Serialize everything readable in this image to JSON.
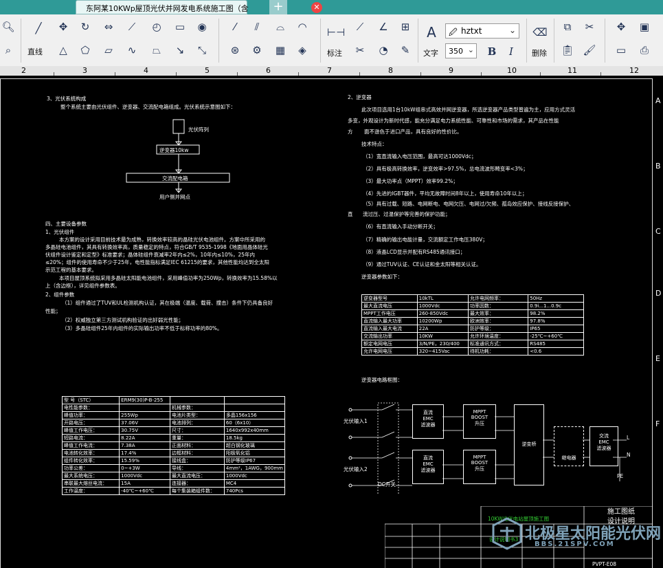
{
  "window": {
    "tab_title": "东阿某10KWp屋顶光伏并网发电系统施工图（含",
    "close_glyph": "✕",
    "new_tab_glyph": "+"
  },
  "toolbar": {
    "line_label": "直线",
    "dimension_label": "标注",
    "text_label": "文字",
    "delete_label": "删除",
    "font_name": "hztxt",
    "font_size": "350",
    "bold": "B",
    "italic": "I",
    "text_glyph": "A"
  },
  "ruler": {
    "numbers": [
      "2",
      "3",
      "4",
      "5",
      "6",
      "7",
      "8",
      "9",
      "10",
      "11",
      "12"
    ]
  },
  "row_letters": [
    "A",
    "B",
    "C",
    "D",
    "E",
    "F"
  ],
  "doc": {
    "left": {
      "sec3_title": "3、光伏系统构成",
      "sec3_body": "整个系统主要由光伏组件、逆变器、交流配电箱组成。光伏系统示意图如下：",
      "flow": {
        "pv": "光伏阵列",
        "inv": "逆变器10kw",
        "ac": "交流配电箱",
        "grid": "用户侧并网点"
      },
      "sec4_title": "四、主要设备参数",
      "p1_title": "1、光伏组件",
      "p1_l1": "本方案的设计采用目前技术最为成熟，转换效率较高的晶硅光伏电池组件。方案中所采用的",
      "p1_l2": "多晶硅电池组件，其具有转换效率高，质量稳定的特点，符合GB/T 9535-1998《地面用晶体硅光",
      "p1_l3": "伏组件设计鉴定和定型》标准要求；晶体硅组件衰减率2年内≤2%，10年内≤10%，25年内",
      "p1_l4": "≤20%；组件的使用寿命不少于25年，电性能指标满足IEC 61215的要求，其他性能均达到全太阳",
      "p1_l5": "示范工程的基本要求。",
      "p1_l6": "本项目屋顶系统拟采用多晶硅太阳能电池组件，采用峰值功率为250Wp，转换效率为15.58%以",
      "p1_l7": "上（含边框），详见组件参数表。",
      "p2_title": "2、组件参数",
      "p2_l1": "（1）组件通过了TUV和UL检测机构认证，其在极端（温度、载荷、撞击）条件下仍具备良好",
      "p2_l2": "性能；",
      "p2_l3": "（2）权威独立第三方测试机构验证的出好弱光性能；",
      "p2_l4": "（3）多晶硅组件25年内组件的实际输出功率不低于标称功率的80%。"
    },
    "module_table": {
      "rows": [
        [
          "型 号（STC）",
          "ERM9(30)P-B-255",
          "",
          ""
        ],
        [
          "电性能参数：",
          "",
          "机械参数：",
          ""
        ],
        [
          "峰值功率：",
          "255Wp",
          "电池片类型：",
          "多晶156x156"
        ],
        [
          "开路电压：",
          "37.06V",
          "电池排列：",
          "60（6x10）"
        ],
        [
          "峰值工作电压：",
          "30.75V",
          "尺寸：",
          "1640x992x40mm"
        ],
        [
          "短路电流：",
          "8.22A",
          "重量：",
          "18.5kg"
        ],
        [
          "峰值工作电流：",
          "7.38A",
          "正面材料：",
          "超白钢化玻璃"
        ],
        [
          "电池转化效率：",
          "17.4%",
          "边框材料：",
          "阳极氧化铝"
        ],
        [
          "组件转化效率：",
          "15.59%",
          "接线盒：",
          "防护等级IP67"
        ],
        [
          "功率公差：",
          "0~+3W",
          "导线：",
          "4mm²，1AWG，900mm"
        ],
        [
          "最大系统电压：",
          "1000Vdc",
          "最大直流电压：",
          "1000Vdc"
        ],
        [
          "串联最大熔丝电流：",
          "15A",
          "连接器：",
          "MC4"
        ],
        [
          "工作温度：",
          "-40℃~+60℃",
          "每个集装箱组件数：",
          "740Pcs"
        ]
      ]
    },
    "right": {
      "inv_title": "2、逆变器",
      "inv_l1": "此次项目选用1台10kW组串式高效并网逆变器，所选逆变器产品类型普遍为主，应用方式灵活",
      "inv_l2": "多变，外观设计为新时代感，能充分满足电力系统性能、可靠性和市场的需求，其产品在性能",
      "inv_l3a": "方",
      "inv_l3": "面不逊色于进口产品，具有良好的性价比。",
      "feat_title": "技术特点：",
      "f1": "（1）宽直流输入电压范围，最高可达1000Vdc；",
      "f2": "（2）具有极高转换效率，逆变效率>97.5%，总电流波形畸变率<3%；",
      "f3": "（3）最大功率点（MPPT）效率99.2%；",
      "f4": "（4）先进的IGBT器件，平均无故障时间8年以上，使用寿命10年以上；",
      "f5": "（5）具有过载、短路、电网断电、电网欠压、电网过/欠频、孤岛效应保护、接线反接保护、",
      "f5b": "直",
      "f5c": "流过压、过温保护等完善的保护功能；",
      "f6": "（6）有直流输入手动分断开关；",
      "f7": "（7）精确的输出电能计量，交流额定工作电压380V；",
      "f8": "（8）液晶LCD显示并配有RS485通讯接口；",
      "f9": "（9）通过TUV认证、CE认证和金太阳等相关认证。",
      "params_title": "逆变器参数如下：",
      "block_title": "逆变器电路框图："
    },
    "inv_table": {
      "rows": [
        [
          "逆变器型号",
          "10kTL",
          "允许电网频率：",
          "50Hz"
        ],
        [
          "最大直流电压",
          "1000Vdc",
          "功率因数：",
          "0.9i...1...0.9c"
        ],
        [
          "MPPT工作电压",
          "260-850Vdc",
          "最大效率：",
          "98.2%"
        ],
        [
          "直流输入最大功率",
          "10200Wp",
          "欧洲效率：",
          "97.8%"
        ],
        [
          "直流输入最大电流",
          "22A",
          "防护等级：",
          "IP65"
        ],
        [
          "交流输出功率",
          "10KW",
          "允许环境温度：",
          "-25℃~+60℃"
        ],
        [
          "额定电网电压",
          "3/N/PE，230/400",
          "标准通讯方式：",
          "RS485"
        ],
        [
          "允许电网电压",
          "320~415Vac",
          "待机功耗：",
          "<0.6"
        ]
      ]
    },
    "block": {
      "pv1": "光伏输入1",
      "pv2": "光伏输入2",
      "dc_switch": "DC开关",
      "emc1": "直流\nEMC\n滤波器",
      "emc2": "直流\nEMC\n滤波器",
      "boost1": "MPPT\nBOOST\n升压",
      "boost2": "MPPT\nBOOST\n升压",
      "inverter": "逆变桥",
      "relay": "继电器",
      "ac_emc": "交流\nEMC\n滤波器",
      "pe": "PE",
      "l": "L",
      "n": "N"
    },
    "title_block": {
      "project": "10KW光伏电站屋顶施工图",
      "stage": "施工图纸",
      "sheet": "设计说明",
      "sub": "设计说明书3",
      "code": "PVPT-E08"
    },
    "watermark": {
      "main": "北极星太阳能光伏网",
      "url": "BBS.21SPV.COM"
    }
  }
}
